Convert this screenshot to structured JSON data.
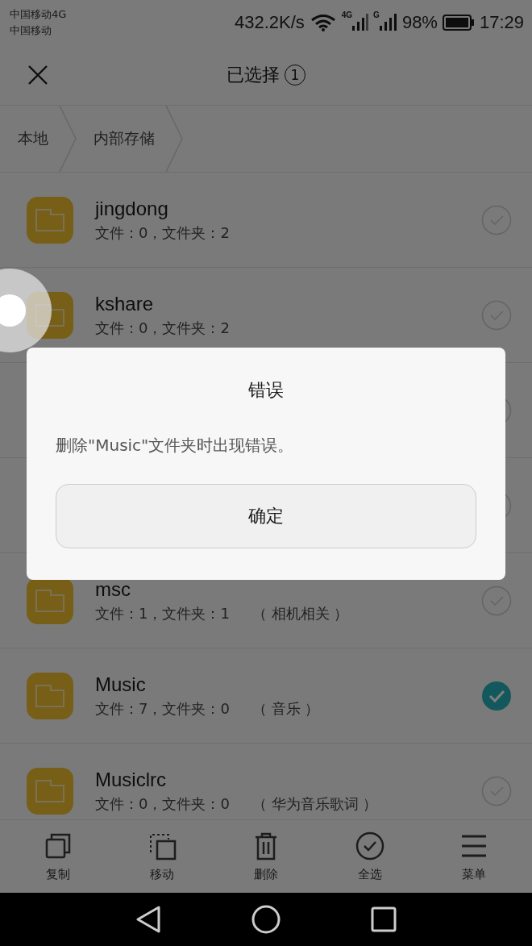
{
  "status_bar": {
    "carrier_1": "中国移动4G",
    "carrier_2": "中国移动",
    "speed": "432.2K/s",
    "signal_1_label": "4G",
    "signal_2_label": "G",
    "battery": "98%",
    "time": "17:29"
  },
  "header": {
    "title": "已选择",
    "count": "1"
  },
  "breadcrumbs": [
    {
      "label": "本地"
    },
    {
      "label": "内部存储"
    }
  ],
  "folders": [
    {
      "name": "jingdong",
      "details": "文件：0，文件夹：2",
      "selected": false
    },
    {
      "name": "kshare",
      "details": "文件：0，文件夹：2",
      "selected": false
    },
    {
      "selected": false
    },
    {
      "selected": false
    },
    {
      "name": "msc",
      "details": "文件：1，文件夹：1",
      "note": "（ 相机相关 ）",
      "selected": false
    },
    {
      "name": "Music",
      "details": "文件：7，文件夹：0",
      "note": "（ 音乐 ）",
      "selected": true
    },
    {
      "name": "Musiclrc",
      "details": "文件：0，文件夹：0",
      "note": "（ 华为音乐歌词 ）",
      "selected": false
    }
  ],
  "toolbar": [
    {
      "kind": "copy",
      "label": "复制"
    },
    {
      "kind": "move",
      "label": "移动"
    },
    {
      "kind": "delete",
      "label": "删除"
    },
    {
      "kind": "select_all",
      "label": "全选"
    },
    {
      "kind": "menu",
      "label": "菜单"
    }
  ],
  "dialog": {
    "title": "错误",
    "message": "删除\"Music\"文件夹时出现错误。",
    "button": "确定"
  }
}
